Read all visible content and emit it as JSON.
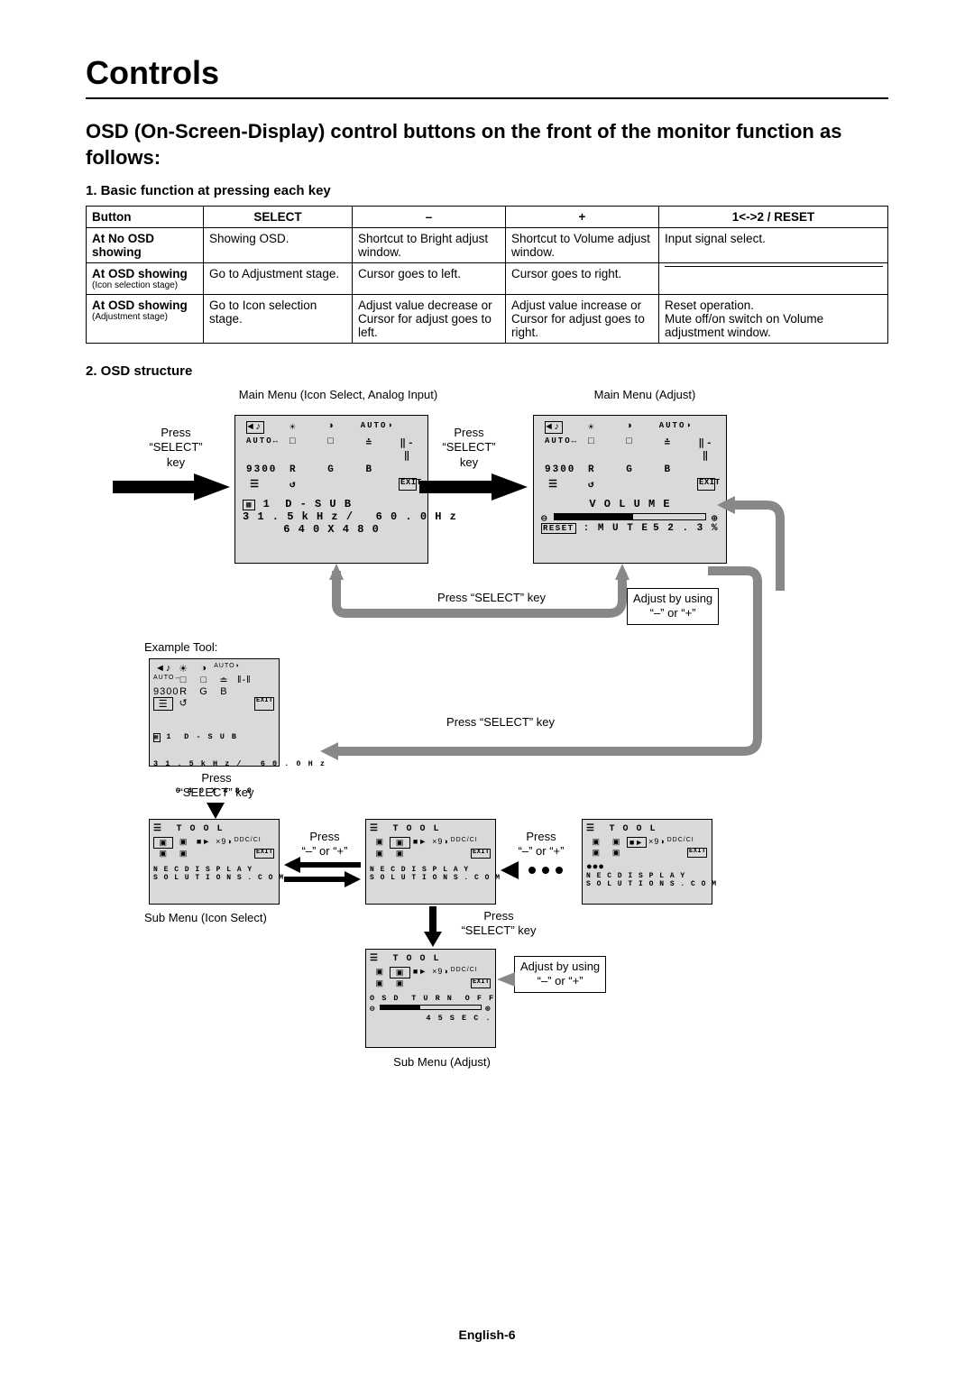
{
  "title": "Controls",
  "intro": "OSD (On-Screen-Display) control buttons on the front of the monitor function as follows:",
  "section1_head": "1. Basic function at pressing each key",
  "section2_head": "2. OSD structure",
  "table": {
    "headers": {
      "c0": "Button",
      "c1": "SELECT",
      "c2": "–",
      "c3": "+",
      "c4": "1<->2 / RESET"
    },
    "row1": {
      "label": "At No OSD showing",
      "c1": "Showing OSD.",
      "c2": "Shortcut to Bright adjust window.",
      "c3": "Shortcut to Volume adjust window.",
      "c4": "Input signal select."
    },
    "row2": {
      "label": "At OSD showing",
      "sub": "(Icon selection stage)",
      "c1": "Go to Adjustment stage.",
      "c2": "Cursor goes to left.",
      "c3": "Cursor goes to right.",
      "c4": ""
    },
    "row3": {
      "label": "At OSD showing",
      "sub": "(Adjustment stage)",
      "c1": "Go to Icon selection stage.",
      "c2": "Adjust value decrease or Cursor for adjust goes to left.",
      "c3": "Adjust value increase or Cursor for adjust goes to right.",
      "c4": "Reset operation.\nMute off/on switch on Volume adjustment window."
    }
  },
  "diagram": {
    "main_menu_icon": "Main Menu (Icon Select, Analog Input)",
    "main_menu_adjust": "Main Menu (Adjust)",
    "example_tool": "Example Tool:",
    "sub_menu_icon": "Sub Menu (Icon Select)",
    "sub_menu_adjust": "Sub Menu (Adjust)",
    "press_select_key": "Press “SELECT” key",
    "press_select_multiline": "Press\n“SELECT”\nkey",
    "press_select_twoline": "Press\n“SELECT” key",
    "press_pm": "Press\n“–” or “+”",
    "adjust_pm": "Adjust by using\n“–” or “+”",
    "osd1_line1": "1  D - S U B",
    "osd1_line2": "3 1 . 5 k H z /   6 0 . 0 H z",
    "osd1_line3": "6 4 0 X 4 8 0",
    "osd2_title": "V O L U M E",
    "osd2_mute": ": M U T E",
    "osd2_pct": "5 2 . 3 %",
    "osd2_reset": "RESET",
    "exit": "EXIT",
    "iconrows_main": {
      "r1": [
        "◄♪",
        "☀",
        "◑",
        "AUTO◑"
      ],
      "r2": [
        "AUTO↔",
        "□",
        "□",
        "≐",
        "‖-‖"
      ],
      "r3": [
        "9300",
        "R",
        "G",
        "B"
      ],
      "r4": [
        "☰",
        "↺"
      ]
    },
    "tool_label": "T O O L",
    "tool_iconrow1": [
      "▣",
      "▣",
      "■►",
      "×9◑",
      "DDC/CI"
    ],
    "tool_iconrow2": [
      "▣",
      "▣"
    ],
    "tool_footer1": "N E C D I S P L A Y",
    "tool_footer2": "S O L U T I O N S . C O M",
    "osd_turnoff": "O S D  T U R N  O F F",
    "osd_turnoff_time": "4 5 S E C ."
  },
  "page_foot": "English-6"
}
